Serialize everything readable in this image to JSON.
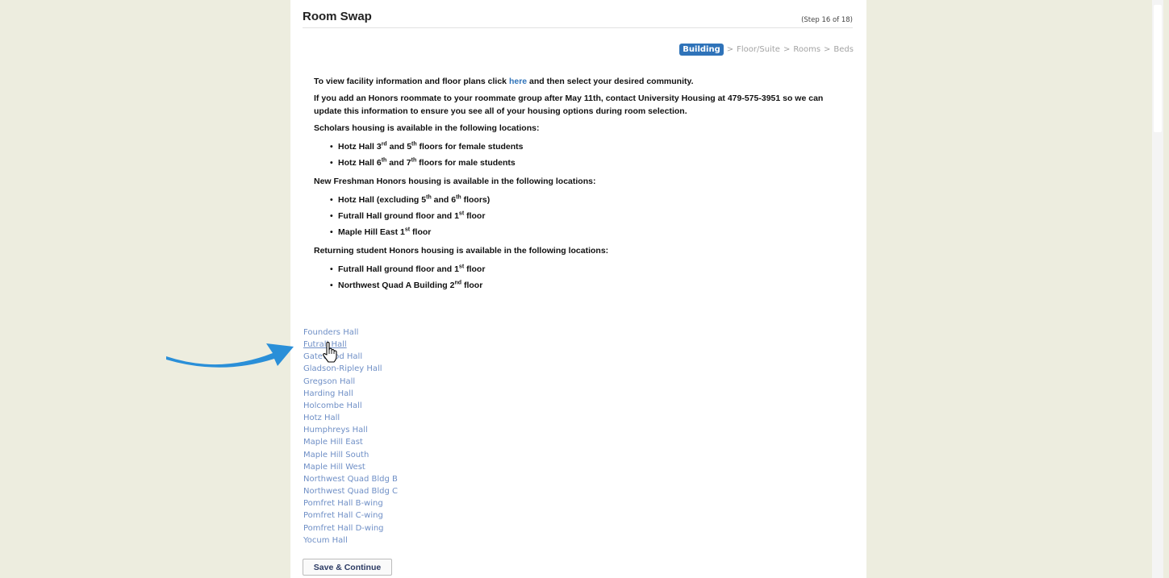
{
  "header": {
    "title": "Room Swap",
    "step": "(Step 16 of 18)"
  },
  "breadcrumb": {
    "active": "Building",
    "sep": ">",
    "steps": [
      "Floor/Suite",
      "Rooms",
      "Beds"
    ]
  },
  "intro": {
    "prefix": "To view facility information and floor plans click ",
    "link": "here",
    "suffix": " and then select your desired community."
  },
  "notice": "If you add an Honors roommate to your roommate group after May 11th, contact University Housing at 479-575-3951 so we can update this information to ensure you see all of your housing options during room selection.",
  "scholars": {
    "heading": "Scholars housing is available in the following locations:",
    "items": [
      {
        "a": "Hotz Hall 3",
        "sup1": "rd",
        "b": " and 5",
        "sup2": "th",
        "c": " floors for female students"
      },
      {
        "a": "Hotz Hall 6",
        "sup1": "th",
        "b": " and 7",
        "sup2": "th",
        "c": " floors for male students"
      }
    ]
  },
  "freshman": {
    "heading": "New Freshman Honors housing is available in the following locations:",
    "item1": {
      "a": "Hotz Hall (excluding 5",
      "sup1": "th",
      "b": " and 6",
      "sup2": "th",
      "c": " floors)"
    },
    "item2": {
      "a": "Futrall Hall ground floor and 1",
      "sup": "st",
      "c": " floor"
    },
    "item3": {
      "a": "Maple Hill East 1",
      "sup": "st",
      "c": " floor"
    }
  },
  "returning": {
    "heading": "Returning student Honors housing is available in the following locations:",
    "item1": {
      "a": "Futrall Hall ground floor and 1",
      "sup": "st",
      "c": " floor"
    },
    "item2": {
      "a": "Northwest Quad A Building 2",
      "sup": "nd",
      "c": " floor"
    }
  },
  "halls": [
    "Founders Hall",
    "Futrall Hall",
    "Gatewood Hall",
    "Gladson-Ripley Hall",
    "Gregson Hall",
    "Harding Hall",
    "Holcombe Hall",
    "Hotz Hall",
    "Humphreys Hall",
    "Maple Hill East",
    "Maple Hill South",
    "Maple Hill West",
    "Northwest Quad Bldg B",
    "Northwest Quad Bldg C",
    "Pomfret Hall B-wing",
    "Pomfret Hall C-wing",
    "Pomfret Hall D-wing",
    "Yocum Hall"
  ],
  "save_label": "Save & Continue",
  "colors": {
    "accent": "#2f73b9",
    "link": "#6f8fc6",
    "arrow": "#2a8fd8"
  },
  "icons": {
    "cursor": "hand-pointer-icon",
    "arrow": "curved-arrow-icon"
  }
}
